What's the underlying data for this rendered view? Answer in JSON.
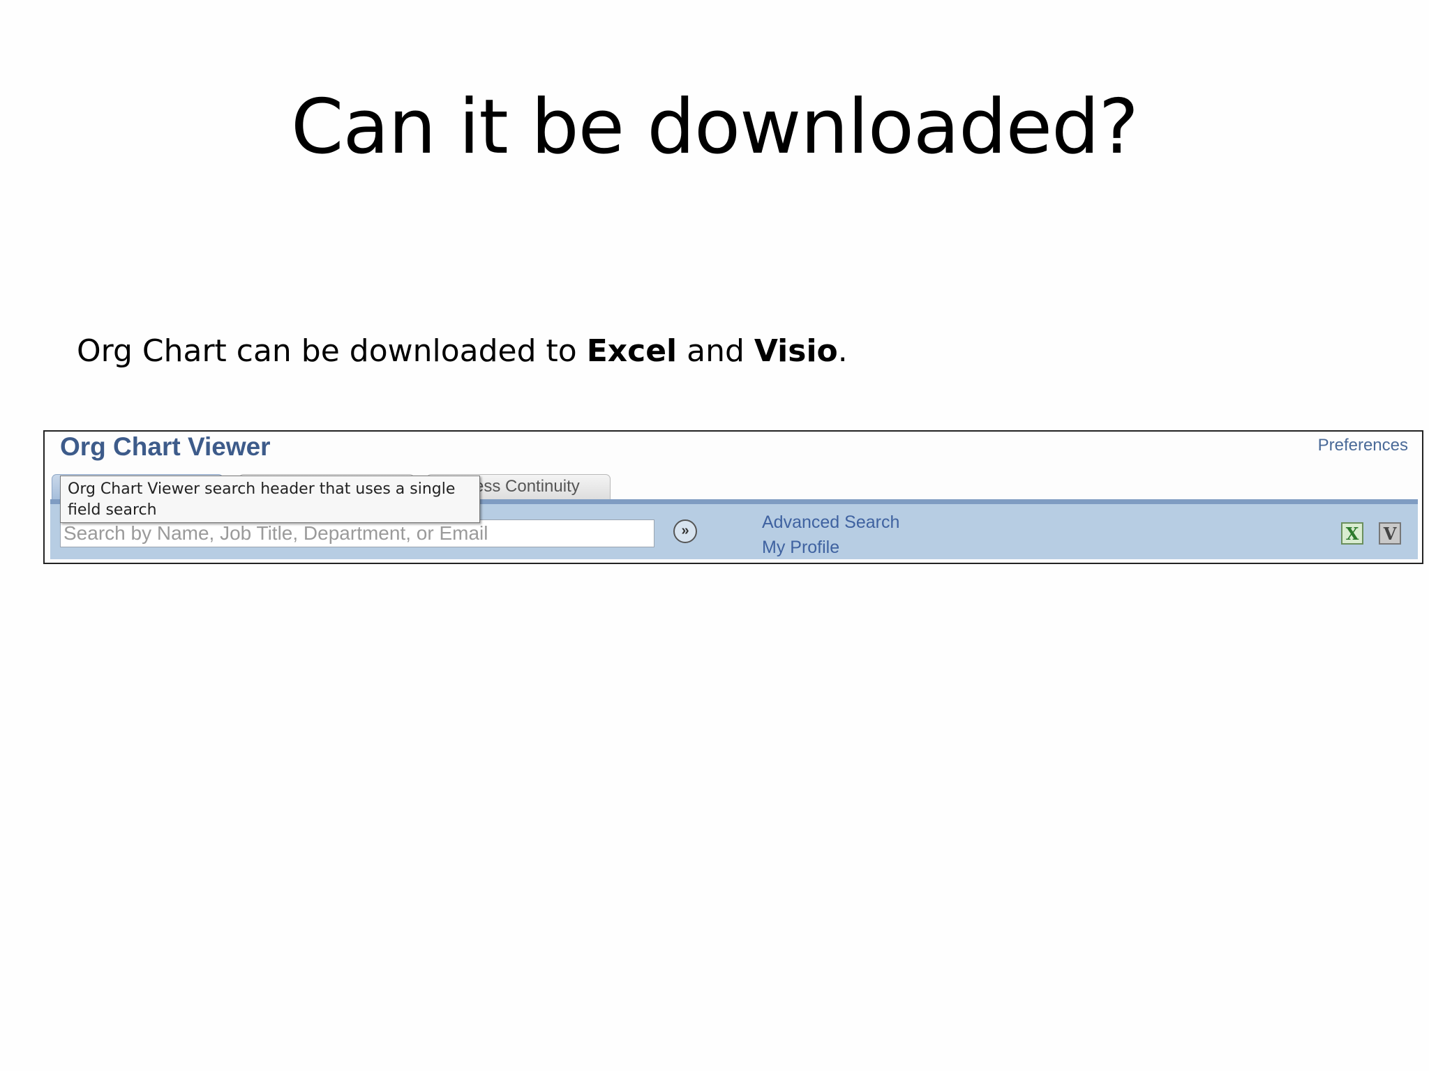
{
  "slide": {
    "title": "Can it be downloaded?",
    "body_prefix": "Org Chart can be downloaded to ",
    "body_excel": "Excel",
    "body_and": " and ",
    "body_visio": "Visio",
    "body_suffix": "."
  },
  "app": {
    "title": "Org Chart Viewer",
    "preferences_label": "Preferences",
    "tabs": [
      {
        "label": ""
      },
      {
        "label": ""
      },
      {
        "label": "ess Continuity"
      }
    ],
    "tooltip": "Org Chart Viewer search header that uses a single field search",
    "search": {
      "placeholder": "Search by Name, Job Title, Department, or Email",
      "value": ""
    },
    "go_icon": "double-chevron-right-icon",
    "go_glyph": "»",
    "links": {
      "advanced_search": "Advanced Search",
      "my_profile": "My Profile"
    },
    "export": {
      "excel_icon": "excel-icon",
      "excel_glyph": "X",
      "visio_icon": "visio-icon",
      "visio_glyph": "V"
    }
  },
  "colors": {
    "title_blue": "#3d5b8a",
    "link_blue": "#3f62a0",
    "bar_blue": "#b7cde3",
    "bar_border": "#7f9cc2"
  }
}
